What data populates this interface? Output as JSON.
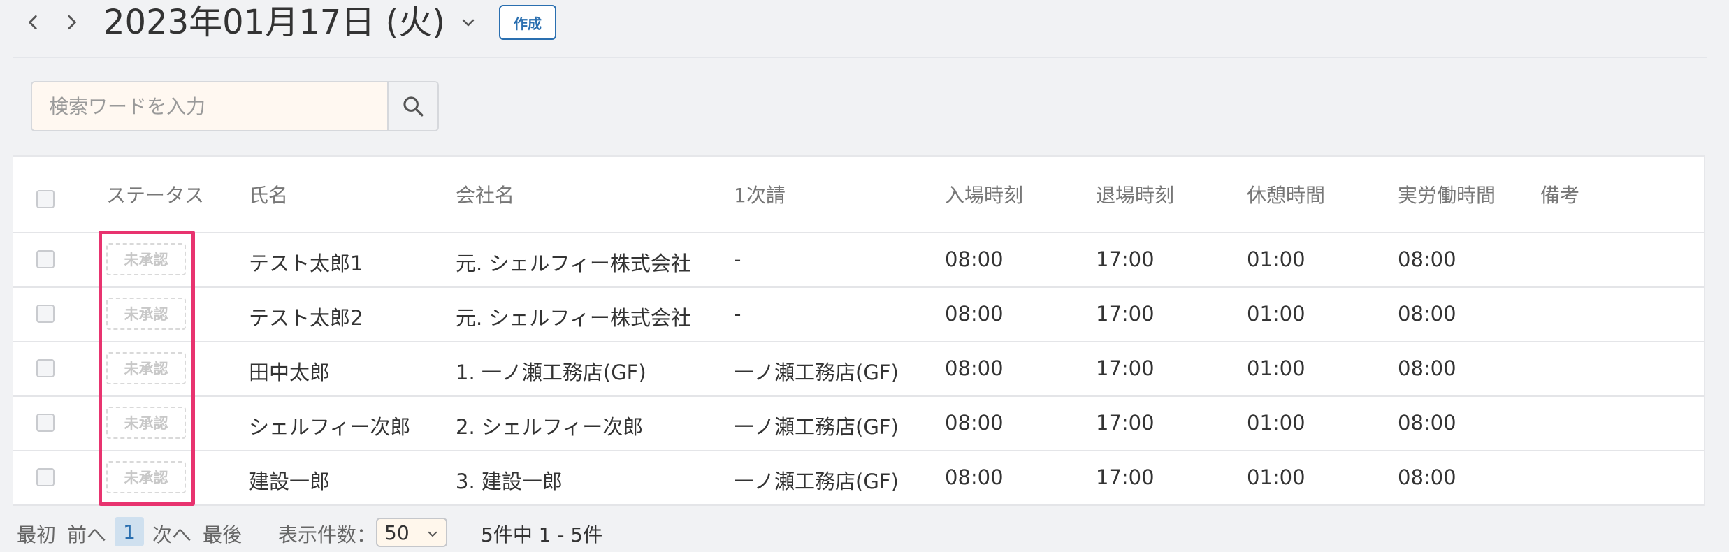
{
  "header": {
    "date_title": "2023年01月17日 (火)",
    "create_label": "作成"
  },
  "search": {
    "placeholder": "検索ワードを入力"
  },
  "table": {
    "columns": [
      "ステータス",
      "氏名",
      "会社名",
      "1次請",
      "入場時刻",
      "退場時刻",
      "休憩時間",
      "実労働時間",
      "備考"
    ],
    "rows": [
      {
        "status": "未承認",
        "name": "テスト太郎1",
        "company": "元. シェルフィー株式会社",
        "primary": "-",
        "entry": "08:00",
        "exit": "17:00",
        "break": "01:00",
        "work": "08:00",
        "note": ""
      },
      {
        "status": "未承認",
        "name": "テスト太郎2",
        "company": "元. シェルフィー株式会社",
        "primary": "-",
        "entry": "08:00",
        "exit": "17:00",
        "break": "01:00",
        "work": "08:00",
        "note": ""
      },
      {
        "status": "未承認",
        "name": "田中太郎",
        "company": "1. 一ノ瀬工務店(GF)",
        "primary": "一ノ瀬工務店(GF)",
        "entry": "08:00",
        "exit": "17:00",
        "break": "01:00",
        "work": "08:00",
        "note": ""
      },
      {
        "status": "未承認",
        "name": "シェルフィー次郎",
        "company": "2. シェルフィー次郎",
        "primary": "一ノ瀬工務店(GF)",
        "entry": "08:00",
        "exit": "17:00",
        "break": "01:00",
        "work": "08:00",
        "note": ""
      },
      {
        "status": "未承認",
        "name": "建設一郎",
        "company": "3. 建設一郎",
        "primary": "一ノ瀬工務店(GF)",
        "entry": "08:00",
        "exit": "17:00",
        "break": "01:00",
        "work": "08:00",
        "note": ""
      }
    ]
  },
  "pager": {
    "first": "最初",
    "prev": "前へ",
    "current": "1",
    "next": "次へ",
    "last": "最後",
    "per_page_label": "表示件数：",
    "per_page_value": "50",
    "summary": "5件中 1 - 5件"
  },
  "colors": {
    "highlight": "#e8336f",
    "accent": "#2a6fb0"
  }
}
